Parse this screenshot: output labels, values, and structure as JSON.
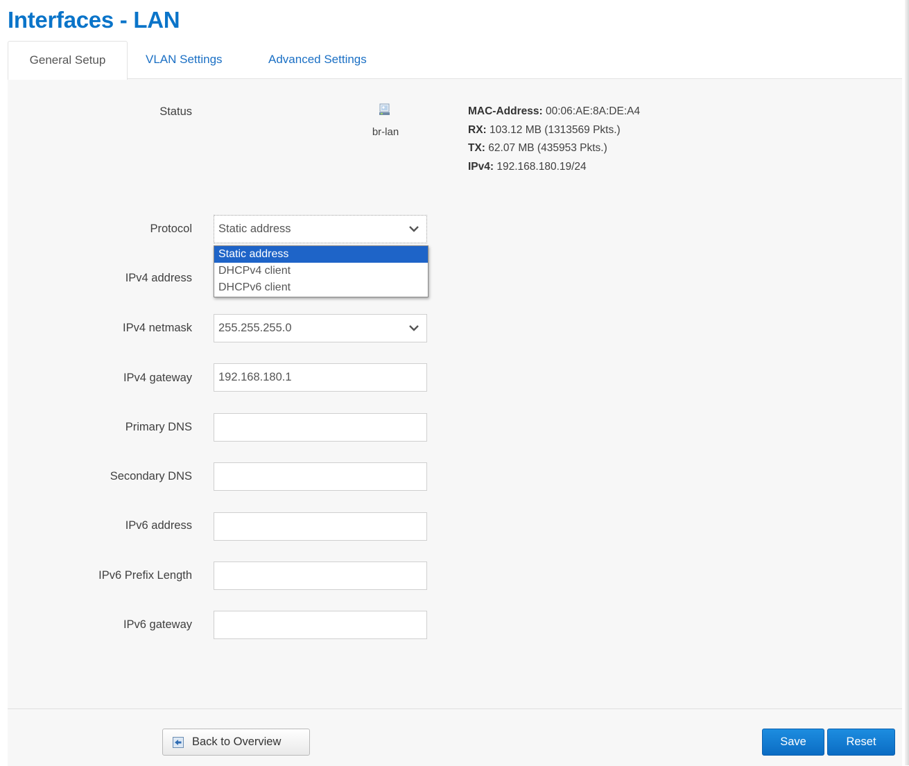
{
  "page": {
    "title": "Interfaces - LAN"
  },
  "tabs": [
    {
      "label": "General Setup",
      "active": true
    },
    {
      "label": "VLAN Settings",
      "active": false
    },
    {
      "label": "Advanced Settings",
      "active": false
    }
  ],
  "status": {
    "label": "Status",
    "interface_name": "br-lan",
    "interface_icon": "network-interface-icon",
    "mac_label": "MAC-Address:",
    "mac_value": " 00:06:AE:8A:DE:A4",
    "rx_label": "RX:",
    "rx_value": " 103.12 MB (1313569 Pkts.)",
    "tx_label": "TX:",
    "tx_value": " 62.07 MB (435953 Pkts.)",
    "ipv4_label": "IPv4:",
    "ipv4_value": " 192.168.180.19/24"
  },
  "form": {
    "protocol": {
      "label": "Protocol",
      "value": "Static address",
      "options": [
        "Static address",
        "DHCPv4 client",
        "DHCPv6 client"
      ],
      "selected_index": 0
    },
    "ipv4_address": {
      "label": "IPv4 address",
      "value": ""
    },
    "ipv4_netmask": {
      "label": "IPv4 netmask",
      "value": "255.255.255.0"
    },
    "ipv4_gateway": {
      "label": "IPv4 gateway",
      "value": "192.168.180.1"
    },
    "primary_dns": {
      "label": "Primary DNS",
      "value": ""
    },
    "secondary_dns": {
      "label": "Secondary DNS",
      "value": ""
    },
    "ipv6_address": {
      "label": "IPv6 address",
      "value": ""
    },
    "ipv6_prefix_length": {
      "label": "IPv6 Prefix Length",
      "value": ""
    },
    "ipv6_gateway": {
      "label": "IPv6 gateway",
      "value": ""
    }
  },
  "footer": {
    "back_label": "Back to Overview",
    "save_label": "Save",
    "reset_label": "Reset"
  },
  "colors": {
    "title": "#0a74c9",
    "tab_link": "#1a6fc4",
    "primary_button": "#0b6cc3",
    "selected_option": "#1e64c8",
    "panel_background": "#f7f7f7"
  }
}
